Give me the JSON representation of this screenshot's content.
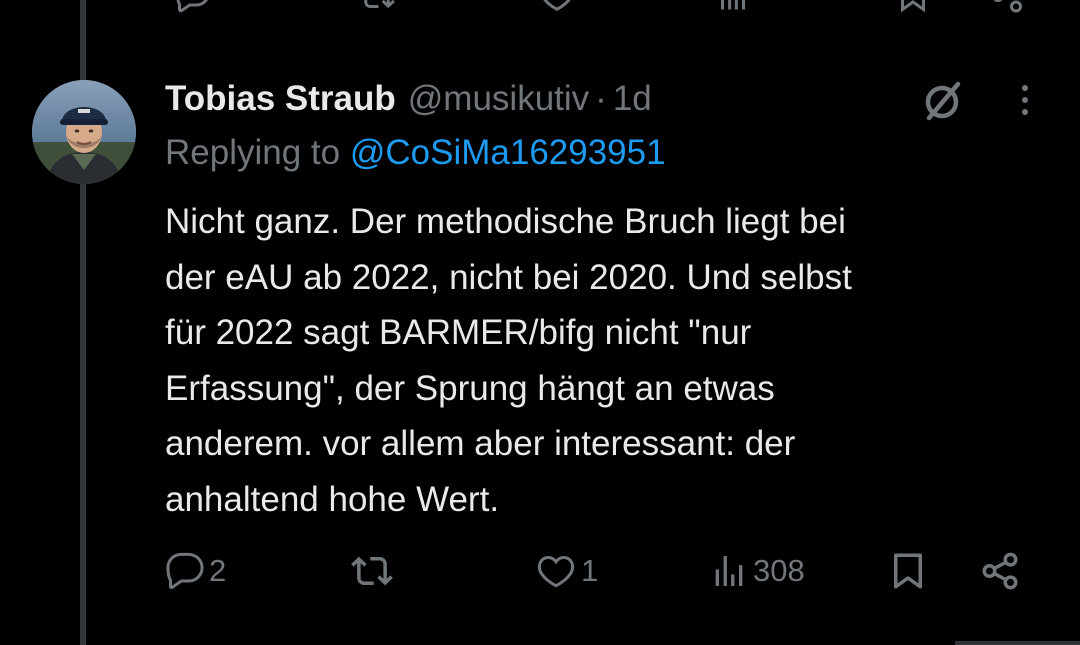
{
  "tweet": {
    "author_name": "Tobias Straub",
    "handle": "@musikutiv",
    "separator": "·",
    "time": "1d",
    "replying_label": "Replying to",
    "replying_to": "@CoSiMa16293951",
    "text": "Nicht ganz. Der methodische Bruch liegt bei\nder eAU ab 2022, nicht bei 2020. Und selbst\nfür 2022 sagt BARMER/bifg nicht \"nur\nErfassung\", der Sprung hängt an etwas\nanderem. vor allem aber interessant: der\nanhaltend hohe Wert."
  },
  "actions": {
    "replies": "2",
    "retweets": "",
    "likes": "1",
    "views": "308"
  },
  "icons": {
    "reply": "reply-icon",
    "retweet": "retweet-icon",
    "like": "heart-icon",
    "views": "views-icon",
    "bookmark": "bookmark-icon",
    "share": "share-icon",
    "grok": "grok-icon",
    "more": "more-icon"
  },
  "colors": {
    "background": "#000000",
    "text": "#e7e9ea",
    "secondary": "#71767b",
    "link": "#1d9bf0",
    "thread_line": "#333639"
  }
}
